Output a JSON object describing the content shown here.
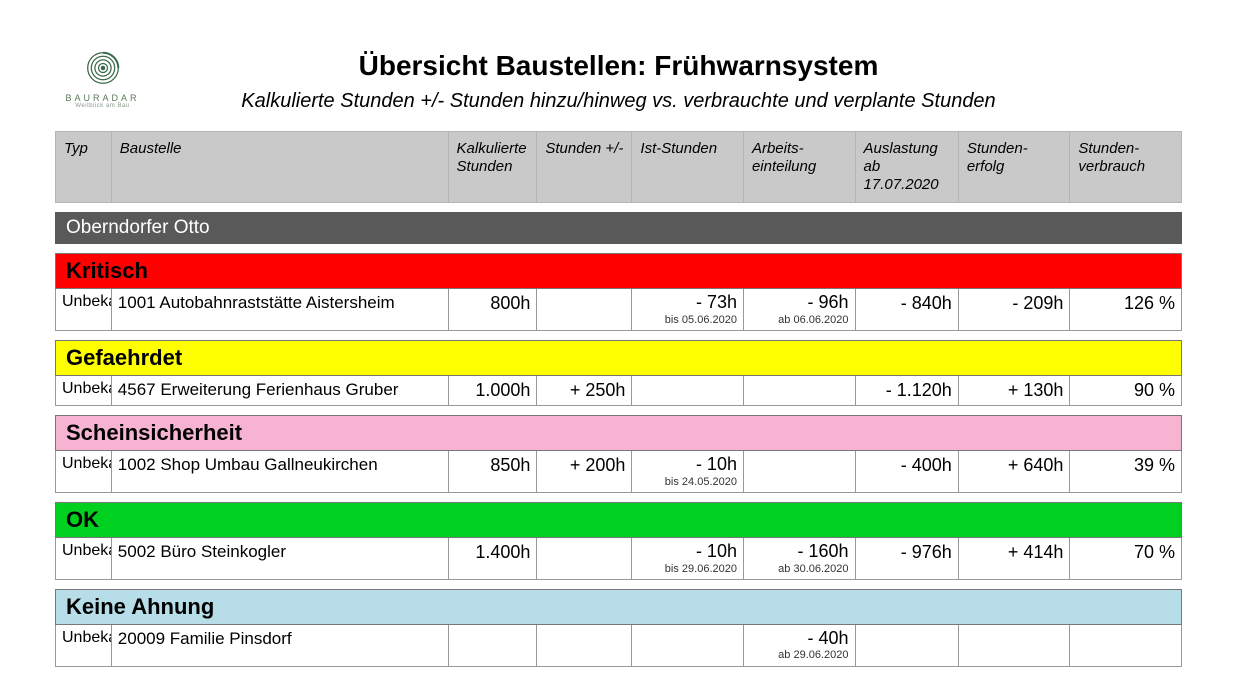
{
  "brand": {
    "name": "BAURADAR",
    "tagline": "Weitblick am Bau"
  },
  "title": "Übersicht Baustellen: Frühwarnsystem",
  "subtitle": "Kalkulierte Stunden +/- Stunden hinzu/hinweg vs. verbrauchte und verplante Stunden",
  "columns": {
    "typ": "Typ",
    "baustelle": "Baustelle",
    "kalkulierte": "Kalkulierte Stunden",
    "stunden_pm": "Stunden +/-",
    "ist": "Ist-Stunden",
    "arbeit": "Arbeits-einteilung",
    "auslastung_line1": "Auslastung ab",
    "auslastung_line2": "17.07.2020",
    "erfolg": "Stunden-erfolg",
    "verbrauch": "Stunden-verbrauch"
  },
  "owner": "Oberndorfer Otto",
  "groups": [
    {
      "label": "Kritisch",
      "class": "g-kritisch",
      "rows": [
        {
          "typ": "Unbekannt",
          "site": "1001 Autobahnraststätte Aistersheim",
          "kalk": "800h",
          "pm": "",
          "ist": "- 73h",
          "ist_note": "bis 05.06.2020",
          "arb": "- 96h",
          "arb_note": "ab 06.06.2020",
          "ausl": "- 840h",
          "erf": "- 209h",
          "verbr": "126 %"
        }
      ]
    },
    {
      "label": "Gefaehrdet",
      "class": "g-gefaehrdet",
      "rows": [
        {
          "typ": "Unbekannt",
          "site": "4567 Erweiterung Ferienhaus Gruber",
          "kalk": "1.000h",
          "pm": "+ 250h",
          "ist": "",
          "ist_note": "",
          "arb": "",
          "arb_note": "",
          "ausl": "- 1.120h",
          "erf": "+ 130h",
          "verbr": "90 %"
        }
      ]
    },
    {
      "label": "Scheinsicherheit",
      "class": "g-schein",
      "rows": [
        {
          "typ": "Unbekannt",
          "site": "1002 Shop Umbau Gallneukirchen",
          "kalk": "850h",
          "pm": "+ 200h",
          "ist": "- 10h",
          "ist_note": "bis 24.05.2020",
          "arb": "",
          "arb_note": "",
          "ausl": "- 400h",
          "erf": "+ 640h",
          "verbr": "39 %"
        }
      ]
    },
    {
      "label": "OK",
      "class": "g-ok",
      "rows": [
        {
          "typ": "Unbekannt",
          "site": "5002 Büro Steinkogler",
          "kalk": "1.400h",
          "pm": "",
          "ist": "- 10h",
          "ist_note": "bis 29.06.2020",
          "arb": "- 160h",
          "arb_note": "ab 30.06.2020",
          "ausl": "- 976h",
          "erf": "+ 414h",
          "verbr": "70 %"
        }
      ]
    },
    {
      "label": "Keine Ahnung",
      "class": "g-keineahnung",
      "rows": [
        {
          "typ": "Unbekannt",
          "site": "20009 Familie Pinsdorf",
          "kalk": "",
          "pm": "",
          "ist": "",
          "ist_note": "",
          "arb": "- 40h",
          "arb_note": "ab 29.06.2020",
          "ausl": "",
          "erf": "",
          "verbr": ""
        }
      ]
    }
  ]
}
